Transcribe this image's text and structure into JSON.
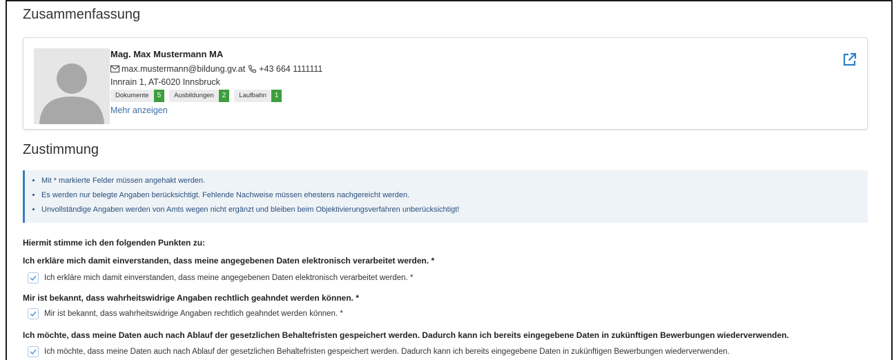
{
  "summary": {
    "title": "Zusammenfassung",
    "person": {
      "name": "Mag. Max Mustermann MA",
      "email": "max.mustermann@bildung.gv.at",
      "phone": "+43 664 1111111",
      "address": "Innrain 1, AT-6020 Innsbruck"
    },
    "badges": [
      {
        "label": "Dokumente",
        "count": "5"
      },
      {
        "label": "Ausbildungen",
        "count": "2"
      },
      {
        "label": "Laufbahn",
        "count": "1"
      }
    ],
    "more_link": "Mehr anzeigen"
  },
  "consent": {
    "title": "Zustimmung",
    "notices": [
      "Mit * markierte Felder müssen angehakt werden.",
      "Es werden nur belegte Angaben berücksichtigt. Fehlende Nachweise müssen ehestens nachgereicht werden.",
      "Unvollständige Angaben werden von Amts wegen nicht ergänzt und bleiben beim Objektivierungsverfahren unberücksichtigt!"
    ],
    "intro": "Hiermit stimme ich den folgenden Punkten zu:",
    "items": [
      {
        "heading": "Ich erkläre mich damit einverstanden, dass meine angegebenen Daten elektronisch verarbeitet werden. *",
        "option": "Ich erkläre mich damit einverstanden, dass meine angegebenen Daten elektronisch verarbeitet werden. *",
        "checked": true
      },
      {
        "heading": "Mir ist bekannt, dass wahrheitswidrige Angaben rechtlich geahndet werden können. *",
        "option": "Mir ist bekannt, dass wahrheitswidrige Angaben rechtlich geahndet werden können. *",
        "checked": true
      },
      {
        "heading": "Ich möchte, dass meine Daten auch nach Ablauf der gesetzlichen Behaltefristen gespeichert werden. Dadurch kann ich bereits eingegebene Daten in zukünftigen Bewerbungen wiederverwenden.",
        "option": "Ich möchte, dass meine Daten auch nach Ablauf der gesetzlichen Behaltefristen gespeichert werden. Dadurch kann ich bereits eingegebene Daten in zukünftigen Bewerbungen wiederverwenden.",
        "checked": true
      }
    ]
  },
  "icons": {
    "email": "envelope-icon",
    "phone": "phone-icon",
    "external": "external-link-icon",
    "check": "check-icon"
  },
  "colors": {
    "link": "#3b6ea8",
    "badge_count": "#3e9e3e",
    "notice_border": "#3a7abf",
    "notice_bg": "#eef3f8"
  }
}
